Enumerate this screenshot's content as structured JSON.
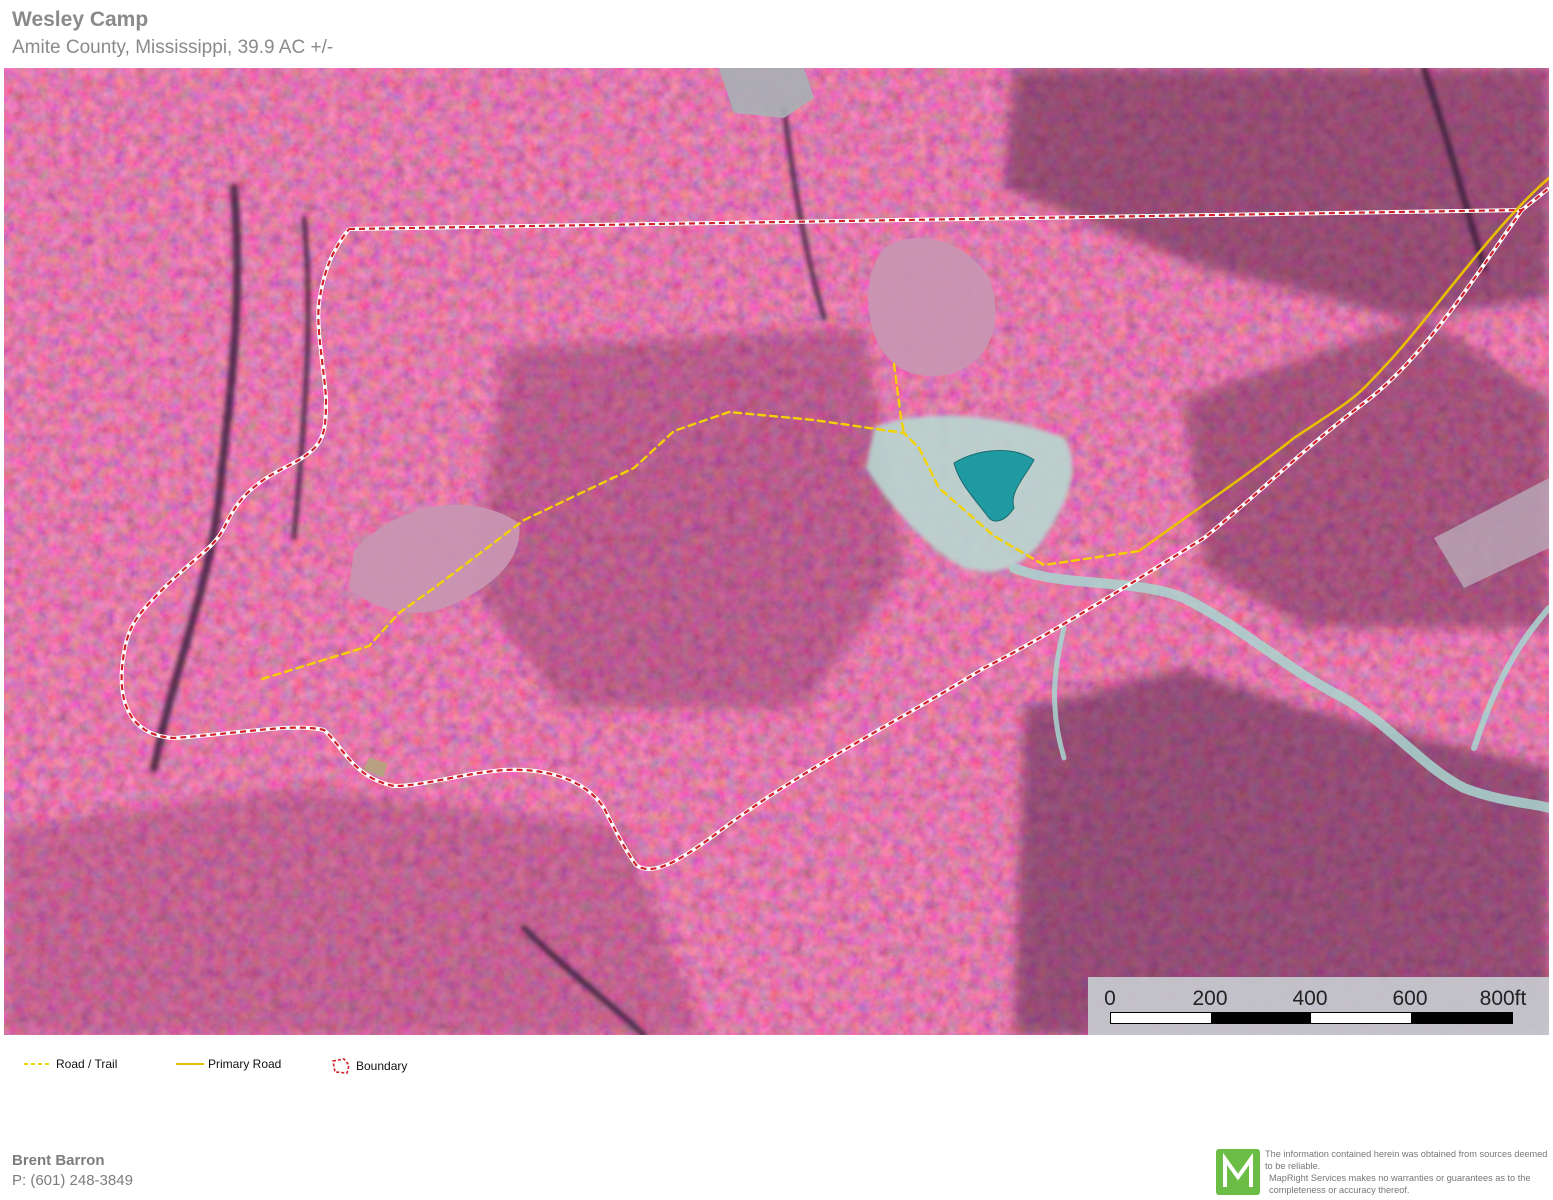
{
  "header": {
    "title": "Wesley Camp",
    "subtitle": "Amite County, Mississippi, 39.9 AC +/-"
  },
  "map": {
    "imagery": "color-infrared aerial photo",
    "colors": {
      "vegetation": "#c8385e",
      "vegetation_dark": "#6a2a4a",
      "field": "#c888a8",
      "water": "#1f9aa0",
      "bare_ground": "#b8d8d0",
      "boundary_white": "#ffffff",
      "boundary_red": "#d0202a",
      "road_trail": "#f2d200",
      "primary_road": "#e8c000"
    },
    "scale": {
      "labels": [
        "0",
        "200",
        "400",
        "600",
        "800ft"
      ]
    }
  },
  "legend": {
    "items": [
      {
        "label": "Road / Trail",
        "icon": "dashed-yellow-line-icon"
      },
      {
        "label": "Primary Road",
        "icon": "solid-yellow-line-icon"
      },
      {
        "label": "Boundary",
        "icon": "boundary-polygon-icon"
      }
    ]
  },
  "footer": {
    "agent_name": "Brent Barron",
    "agent_phone": "P: (601) 248-3849",
    "logo_letter": "M",
    "disclaimer_1": "The information contained herein was obtained from sources deemed to be reliable.",
    "disclaimer_2": "MapRight Services makes no warranties or guarantees as to the completeness or accuracy thereof."
  }
}
